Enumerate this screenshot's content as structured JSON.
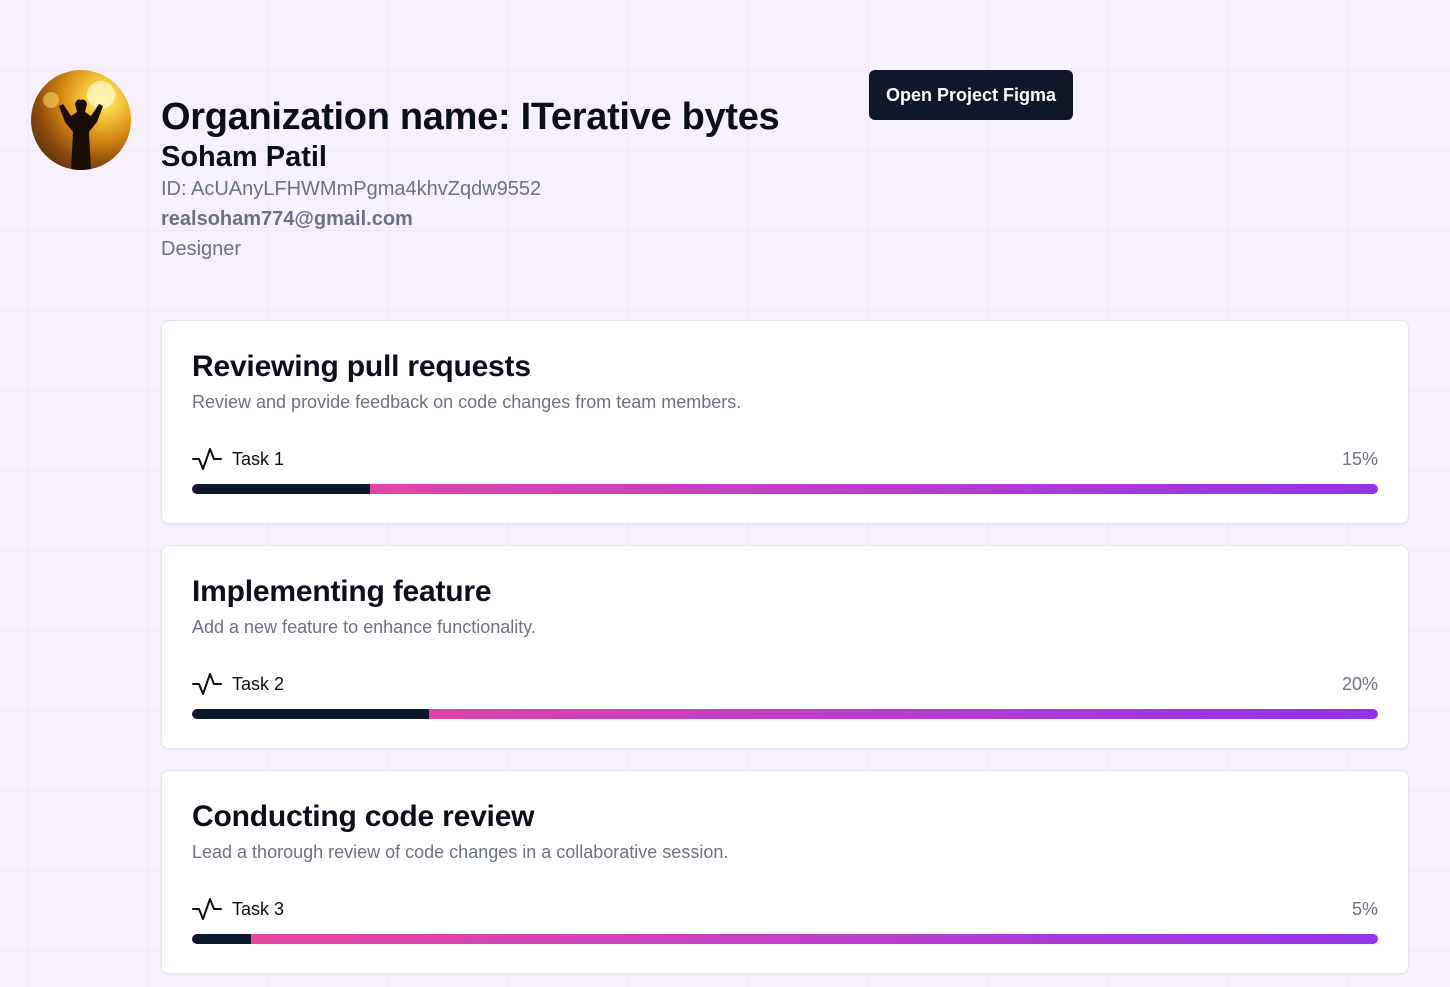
{
  "header": {
    "organization_title": "Organization name: ITerative bytes",
    "user_name": "Soham Patil",
    "user_id": "ID: AcUAnyLFHWMmPgma4khvZqdw9552",
    "email": "realsoham774@gmail.com",
    "role": "Designer",
    "figma_button_label": "Open Project Figma"
  },
  "tasks": [
    {
      "title": "Reviewing pull requests",
      "description": "Review and provide feedback on code changes from team members.",
      "label": "Task 1",
      "percent_text": "15%",
      "progress": 15,
      "icon": "activity-pulse-icon"
    },
    {
      "title": "Implementing feature",
      "description": "Add a new feature to enhance functionality.",
      "label": "Task 2",
      "percent_text": "20%",
      "progress": 20,
      "icon": "activity-pulse-icon"
    },
    {
      "title": "Conducting code review",
      "description": "Lead a thorough review of code changes in a collaborative session.",
      "label": "Task 3",
      "percent_text": "5%",
      "progress": 5,
      "icon": "activity-pulse-icon"
    }
  ],
  "colors": {
    "background": "#f7f1fd",
    "primary_button": "#0f172a",
    "progress_fill": "#0f172a",
    "progress_track_start": "#ec4899",
    "progress_track_end": "#9333ea",
    "muted_text": "#6b7280"
  }
}
